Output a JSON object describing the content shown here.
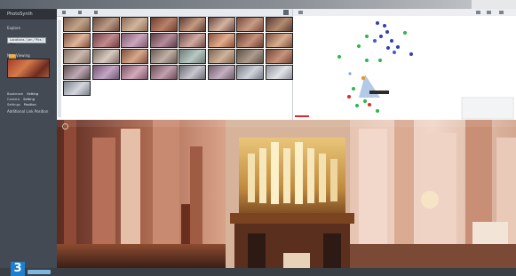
{
  "app": {
    "title": "PhotoSynth"
  },
  "sidebar": {
    "header": "PhotoSynth",
    "section1_label": "Explore",
    "select_value": "Locations / Jan / Pics / Pics",
    "link_text": "Open link / Details link",
    "section2_label": "Now Viewing",
    "rows": [
      {
        "k": "Bookmark",
        "v": "Setting"
      },
      {
        "k": "Camera",
        "v": "Setting"
      },
      {
        "k": "Settings",
        "v": "Position"
      }
    ],
    "footer": "Additional Link Position"
  },
  "badge": "3",
  "colors": {
    "accent_orange": "#e39a27",
    "badge_blue": "#1d7fd0",
    "link_blue": "#7cc5f2",
    "map_blue": "#2f3fb5",
    "map_green": "#2db84a",
    "map_red": "#e02a2a"
  },
  "gallery": {
    "thumbnails": [
      {
        "c1": "#7a5a4a",
        "c2": "#c2a48a"
      },
      {
        "c1": "#6d4a3e",
        "c2": "#b99a86"
      },
      {
        "c1": "#8a6b55",
        "c2": "#d0b59c"
      },
      {
        "c1": "#6f3e2e",
        "c2": "#b9806b"
      },
      {
        "c1": "#5b3c36",
        "c2": "#c49a80"
      },
      {
        "c1": "#6a4540",
        "c2": "#d3b3a0"
      },
      {
        "c1": "#7a4a3b",
        "c2": "#c79c86"
      },
      {
        "c1": "#5a3b2e",
        "c2": "#b38a70"
      },
      {
        "c1": "#7d4f3f",
        "c2": "#e0b59a"
      },
      {
        "c1": "#6d3f44",
        "c2": "#c28b8c"
      },
      {
        "c1": "#7e5a6e",
        "c2": "#c9a6bc"
      },
      {
        "c1": "#5c3d47",
        "c2": "#b48c98"
      },
      {
        "c1": "#6e4b4a",
        "c2": "#d1aaa1"
      },
      {
        "c1": "#8a4e3a",
        "c2": "#e2ae8d"
      },
      {
        "c1": "#6b3e31",
        "c2": "#c4917a"
      },
      {
        "c1": "#7a4f3c",
        "c2": "#d9ae90"
      },
      {
        "c1": "#806b60",
        "c2": "#cbb9ad"
      },
      {
        "c1": "#7b6b62",
        "c2": "#d8cac0"
      },
      {
        "c1": "#7d4e3b",
        "c2": "#d7a88c"
      },
      {
        "c1": "#6a5a53",
        "c2": "#bfb0a6"
      },
      {
        "c1": "#6b7a76",
        "c2": "#b8c8c2"
      },
      {
        "c1": "#7c6350",
        "c2": "#cfb39a"
      },
      {
        "c1": "#5e5046",
        "c2": "#ad9b8c"
      },
      {
        "c1": "#734634",
        "c2": "#c8937b"
      },
      {
        "c1": "#5a4a50",
        "c2": "#bfaab3"
      },
      {
        "c1": "#6e5570",
        "c2": "#c3a6c5"
      },
      {
        "c1": "#7a5466",
        "c2": "#d2a9b9"
      },
      {
        "c1": "#6a4a55",
        "c2": "#c39fad"
      },
      {
        "c1": "#6a6a72",
        "c2": "#c8c6cf"
      },
      {
        "c1": "#6c5a6a",
        "c2": "#c3b0c0"
      },
      {
        "c1": "#777c86",
        "c2": "#d0d3da"
      },
      {
        "c1": "#8b8f98",
        "c2": "#e2e4e8"
      },
      {
        "c1": "#7a7f88",
        "c2": "#d4d7dd"
      }
    ]
  }
}
